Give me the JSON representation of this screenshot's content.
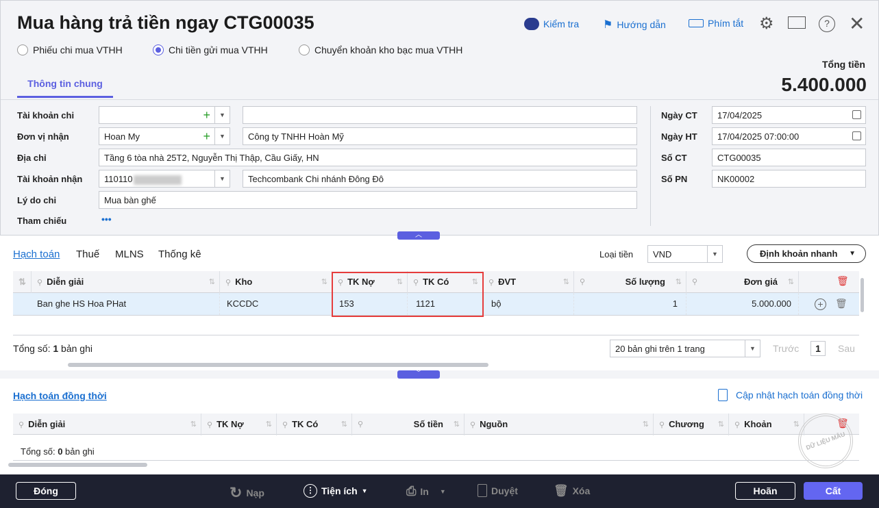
{
  "title": "Mua hàng trả tiền ngay CTG00035",
  "toolbar": {
    "check": "Kiểm tra",
    "guide": "Hướng dẫn",
    "shortcut": "Phím tắt"
  },
  "radios": [
    {
      "label": "Phiếu chi mua VTHH",
      "checked": false
    },
    {
      "label": "Chi tiền gửi mua VTHH",
      "checked": true
    },
    {
      "label": "Chuyển khoản kho bạc mua VTHH",
      "checked": false
    }
  ],
  "tab": "Thông tin chung",
  "total": {
    "label": "Tổng tiền",
    "value": "5.400.000"
  },
  "form": {
    "tk_chi": {
      "label": "Tài khoản chi",
      "value": "",
      "desc": ""
    },
    "don_vi": {
      "label": "Đơn vị nhận",
      "value": "Hoan My",
      "desc": "Công ty TNHH Hoàn Mỹ"
    },
    "dia_chi": {
      "label": "Địa chỉ",
      "value": "Tầng 6 tòa nhà 25T2, Nguyễn Thị Thập, Cầu Giấy, HN"
    },
    "tk_nhan": {
      "label": "Tài khoản nhận",
      "value": "110110",
      "desc": "Techcombank Chi nhánh Đông Đô"
    },
    "ly_do": {
      "label": "Lý do chi",
      "value": "Mua bàn ghế"
    },
    "tham_chieu": {
      "label": "Tham chiếu",
      "value": "•••"
    },
    "ngay_ct": {
      "label": "Ngày CT",
      "value": "17/04/2025"
    },
    "ngay_ht": {
      "label": "Ngày HT",
      "value": "17/04/2025 07:00:00"
    },
    "so_ct": {
      "label": "Số CT",
      "value": "CTG00035"
    },
    "so_pn": {
      "label": "Số PN",
      "value": "NK00002"
    }
  },
  "subtabs": [
    "Hạch toán",
    "Thuế",
    "MLNS",
    "Thống kê"
  ],
  "currency": {
    "label": "Loại tiền",
    "value": "VND"
  },
  "quick": "Định khoản nhanh",
  "grid": {
    "headers": [
      "Diễn giải",
      "Kho",
      "TK Nợ",
      "TK Có",
      "ĐVT",
      "Số lượng",
      "Đơn giá"
    ],
    "rows": [
      [
        "Ban ghe HS Hoa PHat",
        "KCCDC",
        "153",
        "1121",
        "bộ",
        "1",
        "5.000.000"
      ]
    ],
    "total_prefix": "Tổng số: ",
    "total_count": "1",
    "total_suffix": " bản ghi",
    "paging": "20 bản ghi trên 1 trang",
    "prev": "Trước",
    "page": "1",
    "next": "Sau"
  },
  "sim": {
    "title": "Hạch toán đồng thời",
    "update": "Cập nhật hạch toán đồng thời",
    "headers": [
      "Diễn giải",
      "TK Nợ",
      "TK Có",
      "Số tiền",
      "Nguồn",
      "Chương",
      "Khoản"
    ],
    "total_prefix": "Tổng số: ",
    "total_count": "0",
    "total_suffix": " bản ghi"
  },
  "stamp": "DỮ LIỆU MẪU",
  "footer": {
    "close": "Đóng",
    "reload": "Nạp",
    "utils": "Tiện ích",
    "print": "In",
    "approve": "Duyệt",
    "delete": "Xóa",
    "cancel": "Hoãn",
    "save": "Cất"
  },
  "colors": {
    "accent": "#5b5fe0",
    "link": "#1a6fd0",
    "footer": "#1e2130",
    "highlight": "#e63c3c"
  }
}
